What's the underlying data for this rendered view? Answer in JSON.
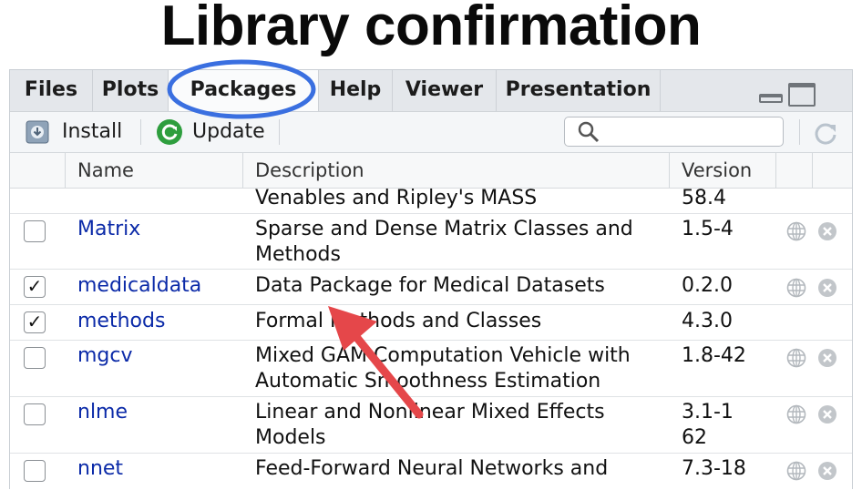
{
  "title": "Library confirmation",
  "tabs": [
    {
      "label": "Files"
    },
    {
      "label": "Plots"
    },
    {
      "label": "Packages"
    },
    {
      "label": "Help"
    },
    {
      "label": "Viewer"
    },
    {
      "label": "Presentation"
    }
  ],
  "toolbar": {
    "install_label": "Install",
    "update_label": "Update",
    "search_placeholder": ""
  },
  "table": {
    "headers": {
      "name": "Name",
      "description": "Description",
      "version": "Version"
    },
    "rows": [
      {
        "name": "",
        "description": "Venables and Ripley's MASS",
        "version": "58.4",
        "checked": false
      },
      {
        "name": "Matrix",
        "description": "Sparse and Dense Matrix Classes and Methods",
        "version": "1.5-4",
        "checked": false
      },
      {
        "name": "medicaldata",
        "description": "Data Package for Medical Datasets",
        "version": "0.2.0",
        "checked": true
      },
      {
        "name": "methods",
        "description": "Formal Methods and Classes",
        "version": "4.3.0",
        "checked": true
      },
      {
        "name": "mgcv",
        "description": "Mixed GAM Computation Vehicle with Automatic Smoothness Estimation",
        "version": "1.8-42",
        "checked": false
      },
      {
        "name": "nlme",
        "description": "Linear and Nonlinear Mixed Effects Models",
        "version": "3.1-162",
        "checked": false
      },
      {
        "name": "nnet",
        "description": "Feed-Forward Neural Networks and",
        "version": "7.3-18",
        "checked": false
      }
    ]
  },
  "colors": {
    "highlight_ellipse": "#3a6fe0",
    "arrow": "#e5474a",
    "link": "#0b2aa8"
  }
}
